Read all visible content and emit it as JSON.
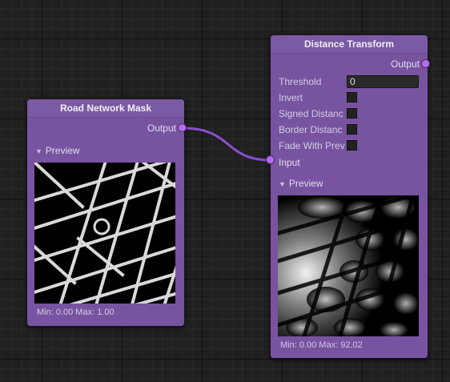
{
  "nodes": {
    "road_mask": {
      "title": "Road Network Mask",
      "output_label": "Output",
      "preview_label": "Preview",
      "stats": "Min: 0.00 Max: 1.00"
    },
    "distance_transform": {
      "title": "Distance Transform",
      "output_label": "Output",
      "input_label": "Input",
      "preview_label": "Preview",
      "stats": "Min: 0.00 Max: 92.02",
      "fields": {
        "threshold": {
          "label": "Threshold",
          "value": "0"
        },
        "invert": {
          "label": "Invert",
          "checked": false
        },
        "signed_distance": {
          "label": "Signed Distanc",
          "checked": false
        },
        "border_distance": {
          "label": "Border Distanc",
          "checked": false
        },
        "fade_with_preview": {
          "label": "Fade With Prev",
          "checked": false
        }
      }
    }
  },
  "colors": {
    "node_body": "#7753a0",
    "port": "#b56ef0",
    "connection": "#8a4fd0"
  }
}
